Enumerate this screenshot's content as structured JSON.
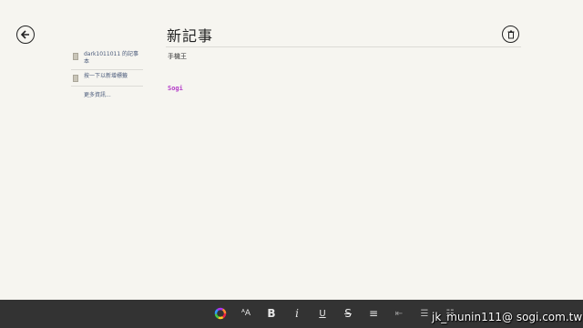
{
  "header": {
    "title": "新記事",
    "back_icon": "arrow-left-icon",
    "delete_icon": "trash-icon"
  },
  "note": {
    "notebook": "手機王",
    "body": "Sogi",
    "body_color": "#b43cc8"
  },
  "sidebar": {
    "items": [
      {
        "label": "dark1011011 的記事本",
        "icon": "notebook-icon"
      },
      {
        "label": "按一下以新增標籤",
        "icon": "tag-icon"
      }
    ],
    "more": "更多資訊..."
  },
  "appbar": {
    "tools": [
      {
        "name": "color-wheel-icon",
        "glyph": ""
      },
      {
        "name": "font-size-icon",
        "glyph": "ᴬA"
      },
      {
        "name": "bold-icon",
        "glyph": "B"
      },
      {
        "name": "italic-icon",
        "glyph": "i"
      },
      {
        "name": "underline-icon",
        "glyph": "U"
      },
      {
        "name": "strikethrough-icon",
        "glyph": "S"
      },
      {
        "name": "align-center-icon",
        "glyph": "≡"
      },
      {
        "name": "indent-icon",
        "glyph": "⇤"
      },
      {
        "name": "bullet-list-icon",
        "glyph": "☰"
      },
      {
        "name": "numbered-list-icon",
        "glyph": "☷"
      }
    ]
  },
  "watermark": "jk_munin111@ sogi.com.tw"
}
